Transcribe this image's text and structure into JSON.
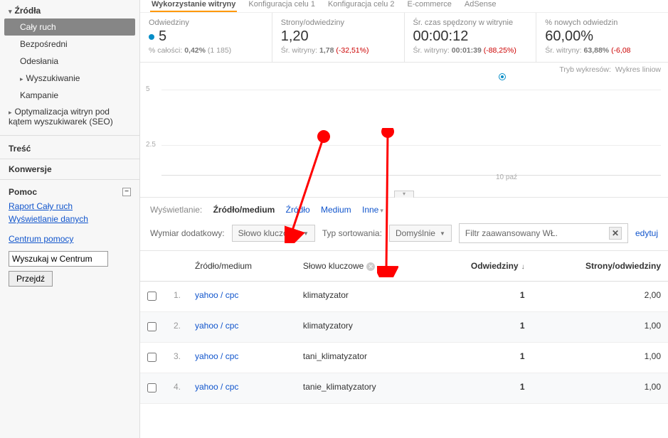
{
  "sidebar": {
    "group_label": "Źródła",
    "items": [
      "Cały ruch",
      "Bezpośredni",
      "Odesłania",
      "Wyszukiwanie",
      "Kampanie"
    ],
    "active_index": 0,
    "seo_label": "Optymalizacja witryn pod kątem wyszukiwarek (SEO)",
    "rows": [
      "Treść",
      "Konwersje"
    ]
  },
  "help": {
    "title": "Pomoc",
    "links": [
      "Raport Cały ruch",
      "Wyświetlanie danych",
      "Centrum pomocy"
    ],
    "search_placeholder": "Wyszukaj w Centrum",
    "search_btn": "Przejdź"
  },
  "top_tabs": [
    "Wykorzystanie witryny",
    "Konfiguracja celu 1",
    "Konfiguracja celu 2",
    "E-commerce",
    "AdSense"
  ],
  "metrics": {
    "visits": {
      "label": "Odwiedziny",
      "value": "5",
      "sub_prefix": "% całości: ",
      "sub_pct": "0,42%",
      "sub_total": "(1 185)"
    },
    "pages": {
      "label": "Strony/odwiedziny",
      "value": "1,20",
      "sub_prefix": "Śr. witryny: ",
      "sub_val": "1,78",
      "delta": "(-32,51%)"
    },
    "time": {
      "label": "Śr. czas spędzony w witrynie",
      "value": "00:00:12",
      "sub_prefix": "Śr. witryny: ",
      "sub_val": "00:01:39",
      "delta": "(-88,25%)"
    },
    "newv": {
      "label": "% nowych odwiedzin",
      "value": "60,00%",
      "sub_prefix": "Śr. witryny: ",
      "sub_val": "63,88%",
      "delta": "(-6,08"
    }
  },
  "chart": {
    "mode_label": "Tryb wykresów:",
    "mode_value": "Wykres liniow",
    "y5": "5",
    "y25": "2.5",
    "xtick": "10 paź",
    "handle": "▾"
  },
  "dim_row": {
    "label": "Wyświetlanie:",
    "opts": [
      "Źródło/medium",
      "Źródło",
      "Medium",
      "Inne"
    ]
  },
  "filter": {
    "dim2_label": "Wymiar dodatkowy:",
    "dim2_val": "Słowo kluczowe",
    "sort_label": "Typ sortowania:",
    "sort_val": "Domyślnie",
    "adv": "Filtr zaawansowany WŁ.",
    "x": "✕",
    "edit": "edytuj"
  },
  "table": {
    "headers": {
      "src": "Źródło/medium",
      "kw": "Słowo kluczowe",
      "visits": "Odwiedziny",
      "pages": "Strony/odwiedziny"
    },
    "rows": [
      {
        "n": "1.",
        "src": "yahoo / cpc",
        "kw": "klimatyzator",
        "visits": "1",
        "pages": "2,00"
      },
      {
        "n": "2.",
        "src": "yahoo / cpc",
        "kw": "klimatyzatory",
        "visits": "1",
        "pages": "1,00"
      },
      {
        "n": "3.",
        "src": "yahoo / cpc",
        "kw": "tani_klimatyzator",
        "visits": "1",
        "pages": "1,00"
      },
      {
        "n": "4.",
        "src": "yahoo / cpc",
        "kw": "tanie_klimatyzatory",
        "visits": "1",
        "pages": "1,00"
      }
    ]
  },
  "chart_data": {
    "type": "line",
    "x": [
      "10 paź"
    ],
    "series": [
      {
        "name": "Odwiedziny",
        "values": [
          5
        ]
      }
    ],
    "ylim": [
      0,
      5
    ],
    "yticks": [
      2.5,
      5
    ],
    "title": "",
    "xlabel": "",
    "ylabel": ""
  }
}
